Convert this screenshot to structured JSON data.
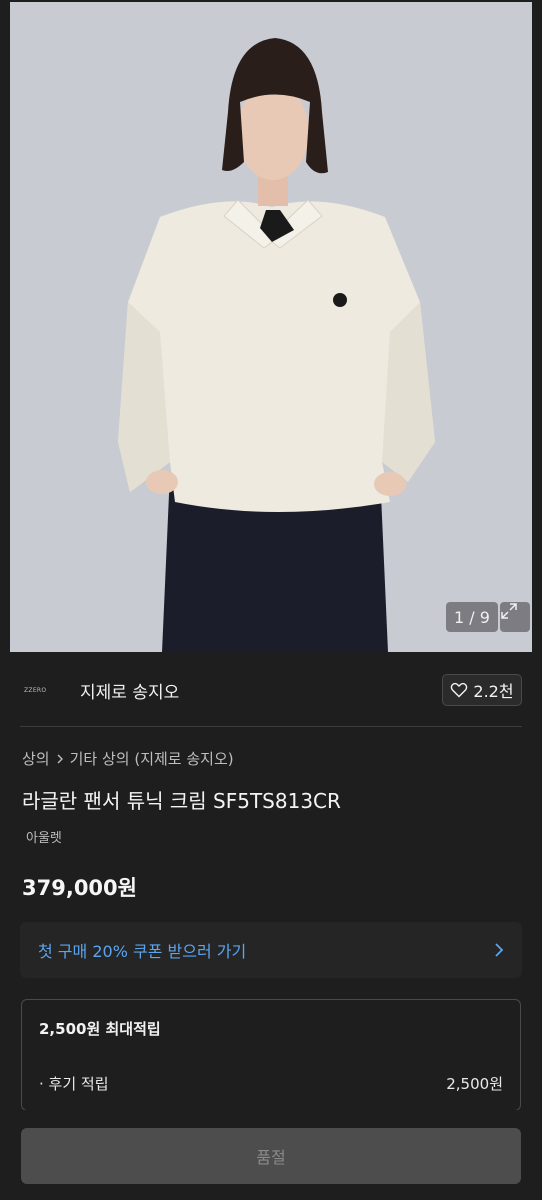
{
  "gallery": {
    "counter": "1 / 9",
    "expand_icon": "expand-icon"
  },
  "brand": {
    "logo_text": "ZZERO",
    "name": "지제로 송지오",
    "like_icon": "heart-icon",
    "like_count": "2.2천"
  },
  "breadcrumb": {
    "category": "상의",
    "separator_icon": "chevron-right-icon",
    "subcategory": "기타 상의 (지제로 송지오)"
  },
  "product": {
    "title": "라글란 팬서 튜닉 크림 SF5TS813CR",
    "tag": "아울렛",
    "price": "379,000원"
  },
  "coupon": {
    "label": "첫 구매 20% 쿠폰 받으러 가기",
    "icon": "chevron-right-icon"
  },
  "points": {
    "title": "2,500원 최대적립",
    "rows": [
      {
        "label": "· 후기 적립",
        "value": "2,500원"
      }
    ]
  },
  "action": {
    "soldout_label": "품절"
  },
  "colors": {
    "background": "#1e1e1e",
    "accent_link": "#5aa5f0",
    "disabled_button": "#4d4d4d"
  }
}
